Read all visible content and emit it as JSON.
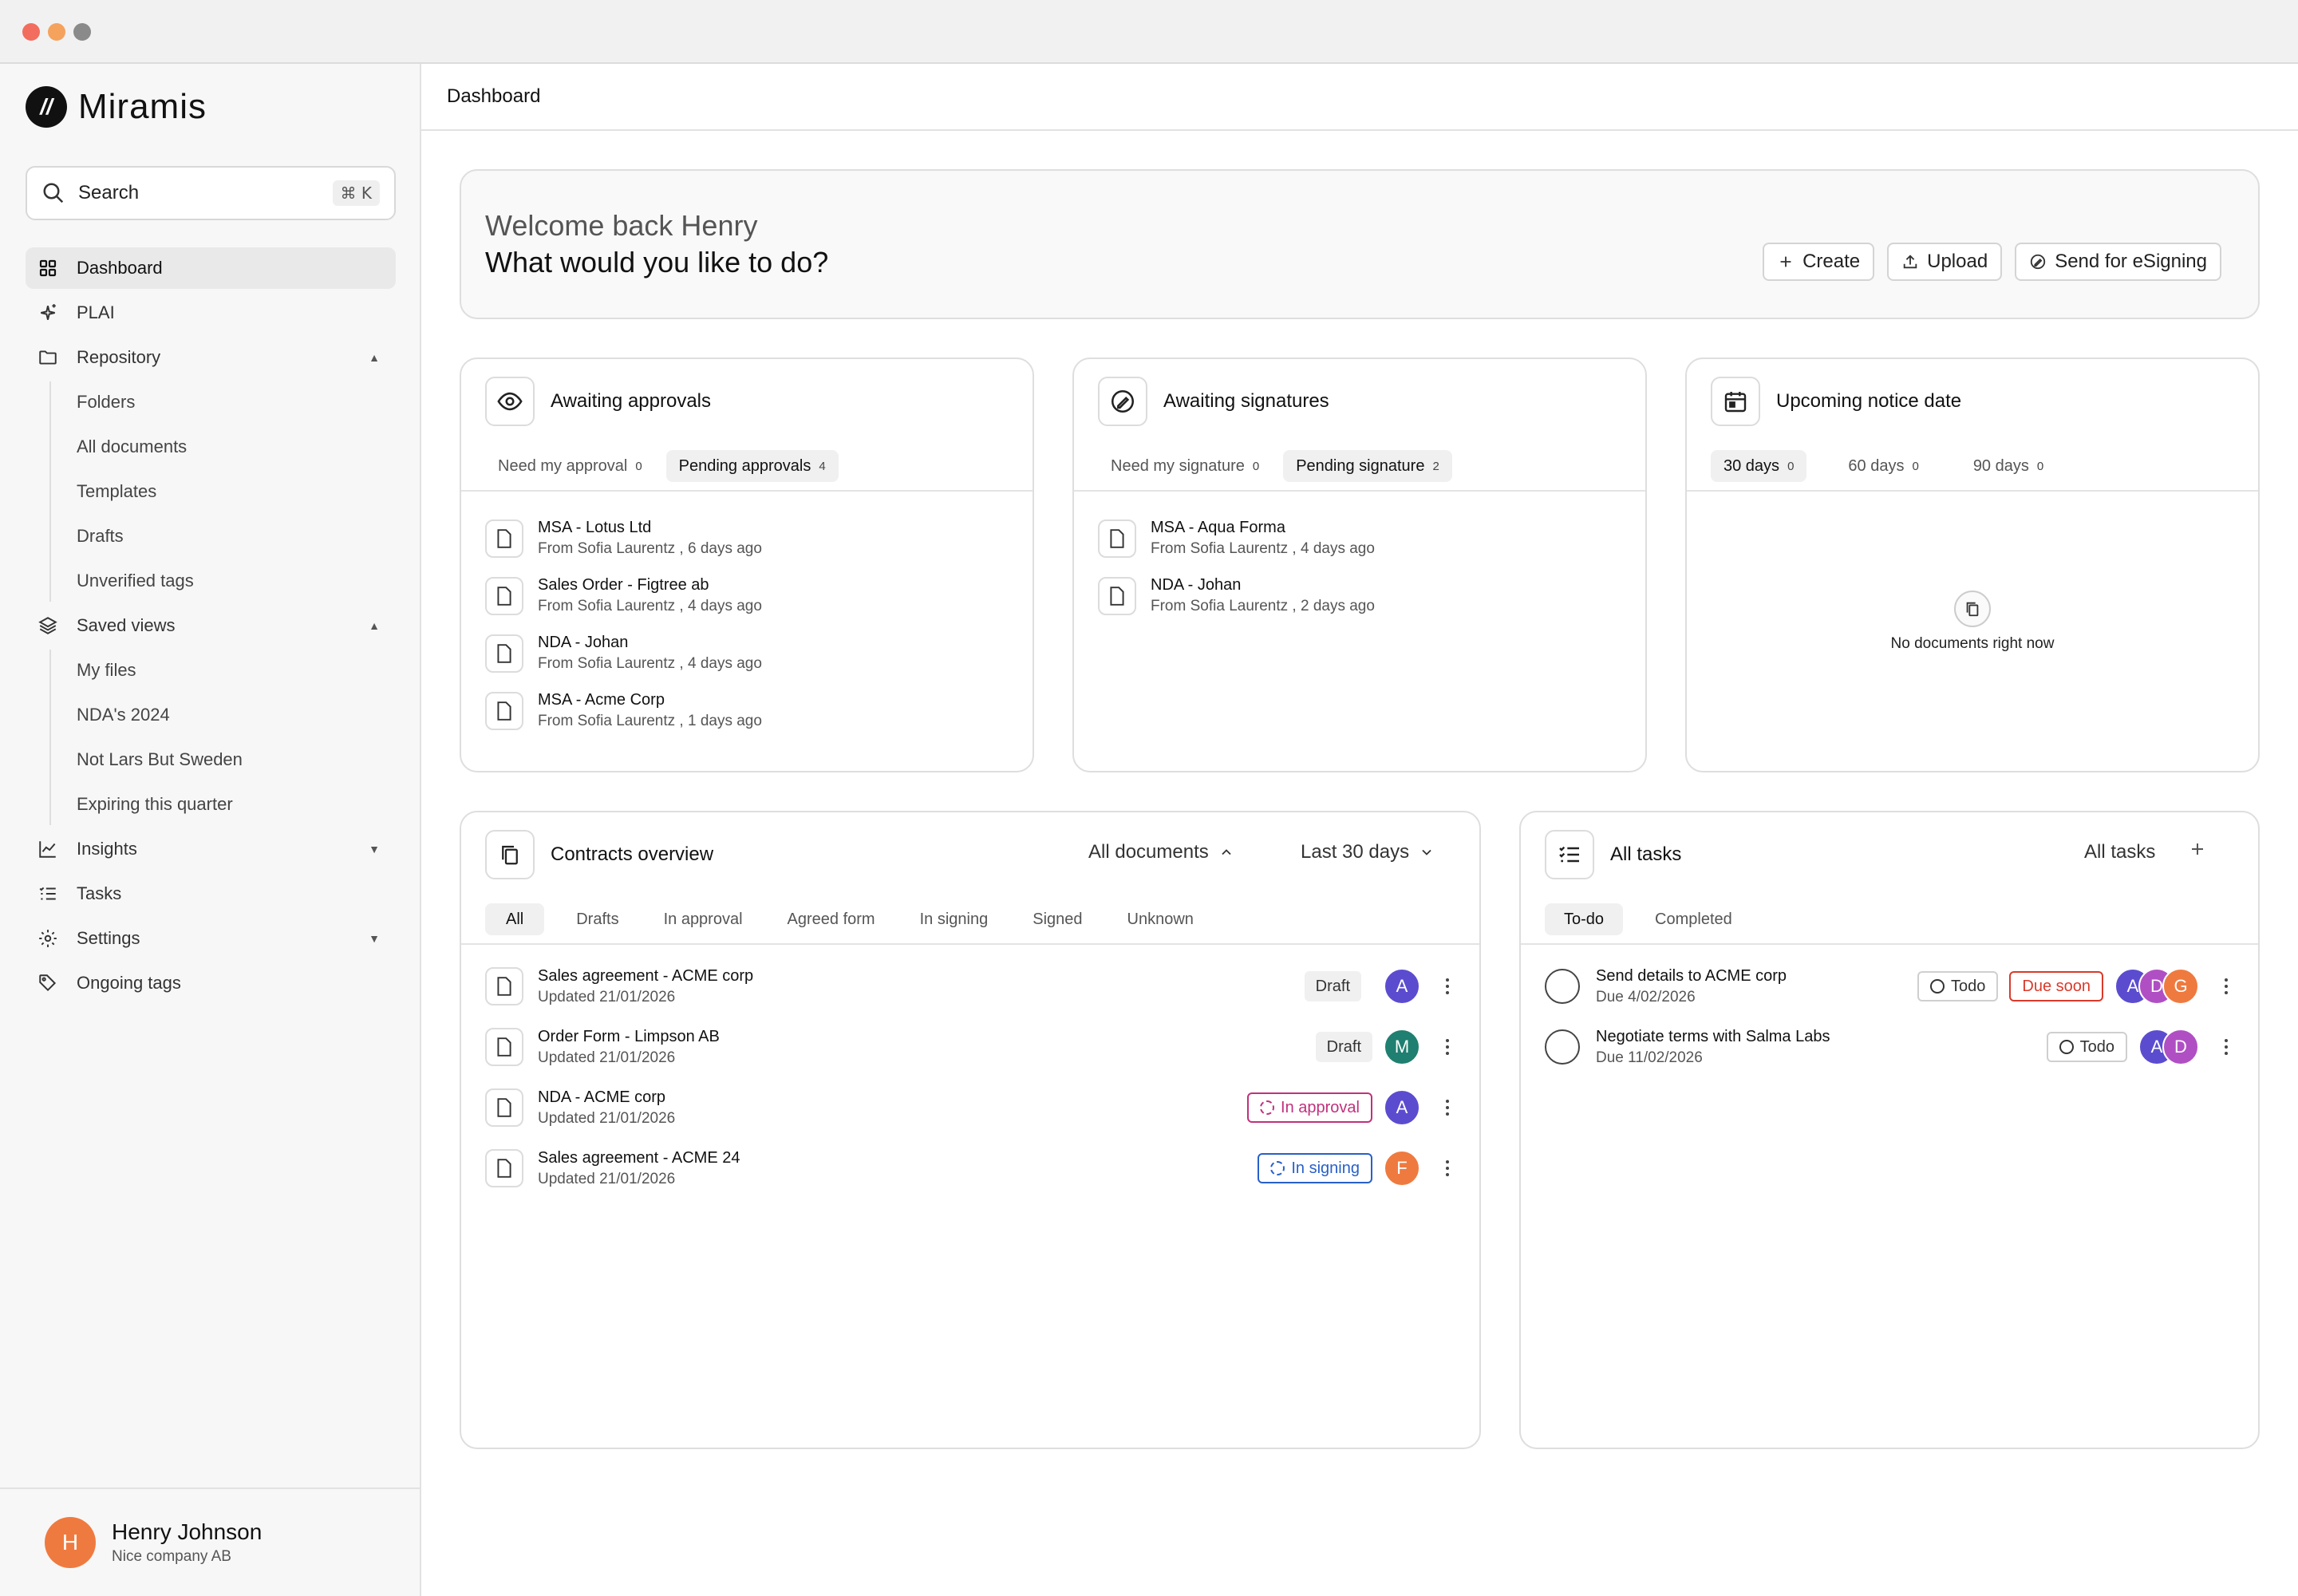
{
  "window": {
    "controls": [
      "close",
      "minimize",
      "maximize"
    ]
  },
  "colors": {
    "close": "#f26d5e",
    "minimize": "#f5a25d",
    "maximize": "#8a8a8a",
    "accent_orange": "#ef7a3f",
    "avatar_purple": "#5b4ccf",
    "avatar_teal": "#1f7f70",
    "avatar_pink": "#b04fc4",
    "approval": "#c0317c",
    "signing": "#2860c8",
    "due": "#d93a2b"
  },
  "brand": {
    "name": "Miramis",
    "icon": "logo-icon"
  },
  "search": {
    "label": "Search",
    "shortcut_symbol": "⌘",
    "shortcut_key": "K",
    "icon": "search-icon"
  },
  "sidebar": {
    "items": [
      {
        "label": "Dashboard",
        "icon": "grid-icon",
        "active": true
      },
      {
        "label": "PLAI",
        "icon": "sparkle-icon"
      },
      {
        "label": "Repository",
        "icon": "folder-icon",
        "expanded": true,
        "children": [
          "Folders",
          "All documents",
          "Templates",
          "Drafts",
          "Unverified tags"
        ]
      },
      {
        "label": "Saved views",
        "icon": "layers-icon",
        "expanded": true,
        "children": [
          "My files",
          "NDA's 2024",
          "Not Lars But Sweden",
          "Expiring this quarter"
        ]
      },
      {
        "label": "Insights",
        "icon": "chart-icon",
        "expanded": false
      },
      {
        "label": "Tasks",
        "icon": "tasks-icon"
      },
      {
        "label": "Settings",
        "icon": "gear-icon",
        "expanded": false
      },
      {
        "label": "Ongoing tags",
        "icon": "tag-icon"
      }
    ]
  },
  "user": {
    "initial": "H",
    "name": "Henry Johnson",
    "company": "Nice company AB"
  },
  "topbar": {
    "title": "Dashboard"
  },
  "welcome": {
    "greeting": "Welcome back Henry",
    "question": "What would you like to do?",
    "buttons": [
      {
        "label": "Create",
        "icon": "plus-icon"
      },
      {
        "label": "Upload",
        "icon": "upload-icon"
      },
      {
        "label": "Send for eSigning",
        "icon": "sign-icon"
      }
    ]
  },
  "approvals": {
    "title": "Awaiting approvals",
    "icon": "eye-icon",
    "tabs": [
      {
        "label": "Need my approval",
        "count": "0"
      },
      {
        "label": "Pending approvals",
        "count": "4",
        "active": true
      }
    ],
    "docs": [
      {
        "title": "MSA - Lotus Ltd",
        "sub": "From Sofia Laurentz , 6 days ago"
      },
      {
        "title": "Sales Order - Figtree ab",
        "sub": "From Sofia Laurentz , 4 days ago"
      },
      {
        "title": "NDA - Johan",
        "sub": "From Sofia Laurentz ,  4 days ago"
      },
      {
        "title": "MSA - Acme Corp",
        "sub": "From Sofia Laurentz , 1 days ago"
      }
    ]
  },
  "signatures": {
    "title": "Awaiting signatures",
    "icon": "pen-icon",
    "tabs": [
      {
        "label": "Need my signature",
        "count": "0"
      },
      {
        "label": "Pending signature",
        "count": "2",
        "active": true
      }
    ],
    "docs": [
      {
        "title": "MSA - Aqua Forma",
        "sub": "From Sofia Laurentz , 4 days ago"
      },
      {
        "title": "NDA - Johan",
        "sub": "From Sofia Laurentz , 2 days ago"
      }
    ]
  },
  "notice": {
    "title": "Upcoming notice date",
    "icon": "calendar-icon",
    "tabs": [
      {
        "label": "30 days",
        "count": "0",
        "active": true
      },
      {
        "label": "60 days",
        "count": "0"
      },
      {
        "label": "90 days",
        "count": "0"
      }
    ],
    "empty": "No documents right now"
  },
  "contracts": {
    "title": "Contracts overview",
    "icon": "copy-icon",
    "filter": "All documents",
    "period": "Last 30 days",
    "tabs": [
      "All",
      "Drafts",
      "In approval",
      "Agreed form",
      "In signing",
      "Signed",
      "Unknown"
    ],
    "rows": [
      {
        "title": "Sales agreement - ACME corp",
        "updated": "Updated 21/01/2026",
        "status": "Draft",
        "status_type": "draft",
        "avatar": "A",
        "avatar_color": "#5b4ccf"
      },
      {
        "title": "Order Form - Limpson AB",
        "updated": "Updated 21/01/2026",
        "status": "Draft",
        "status_type": "draft",
        "avatar": "M",
        "avatar_color": "#1f7f70"
      },
      {
        "title": "NDA - ACME corp",
        "updated": "Updated 21/01/2026",
        "status": "In approval",
        "status_type": "approval",
        "avatar": "A",
        "avatar_color": "#5b4ccf"
      },
      {
        "title": "Sales agreement - ACME 24",
        "updated": "Updated 21/01/2026",
        "status": "In signing",
        "status_type": "signing",
        "avatar": "F",
        "avatar_color": "#ef7a3f"
      }
    ]
  },
  "tasks": {
    "title": "All tasks",
    "icon": "checklist-icon",
    "filter": "All tasks",
    "tabs": [
      "To-do",
      "Completed"
    ],
    "rows": [
      {
        "title": "Send details to ACME corp",
        "due": "Due 4/02/2026",
        "status": "Todo",
        "flag": "Due soon",
        "avatars": [
          {
            "l": "A",
            "c": "#5b4ccf"
          },
          {
            "l": "D",
            "c": "#b04fc4"
          },
          {
            "l": "G",
            "c": "#ef7a3f"
          }
        ]
      },
      {
        "title": "Negotiate terms with Salma Labs",
        "due": "Due 11/02/2026",
        "status": "Todo",
        "flag": "",
        "avatars": [
          {
            "l": "A",
            "c": "#5b4ccf"
          },
          {
            "l": "D",
            "c": "#b04fc4"
          }
        ]
      }
    ]
  }
}
